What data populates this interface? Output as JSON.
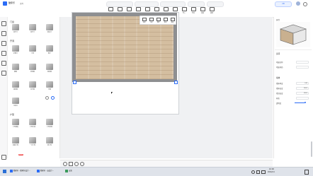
{
  "top": {
    "brand": "酷家乐",
    "file_label": "文件",
    "tools": [
      "撤销",
      "恢复",
      "保存",
      "分享",
      "绘制",
      "方案",
      "工具",
      "视图",
      "导入",
      "导出",
      "渲染",
      "清单"
    ],
    "view_tab": "2D",
    "right_tabs": [
      "渲染",
      "模型",
      "材质"
    ]
  },
  "left": {
    "section_1": "门窗",
    "section_2": "户型",
    "section_3": "开洞",
    "items_1": [
      "单开门",
      "双开门",
      "推拉门",
      "折叠门",
      "门洞",
      "窗户",
      "飘窗",
      "转角窗",
      "弧形窗",
      "落地窗",
      "百叶窗",
      "天窗",
      "垃圾口"
    ],
    "items_2": [
      "户型模板",
      "户型外墙",
      "户型绘制",
      "参数户型",
      "一字户型",
      "新户型"
    ],
    "badge": "NEW"
  },
  "context_toolbar": [
    "绘制",
    "心线",
    "清空",
    "移动",
    "图层"
  ],
  "right": {
    "panel_title": "属性",
    "section_a": "房间",
    "rows": [
      {
        "label": "地面名称",
        "value": ""
      },
      {
        "label": "地面材质",
        "value": ""
      }
    ],
    "section_b": "墙体",
    "rows_b": [
      {
        "label": "墙体厚度",
        "value": "240"
      },
      {
        "label": "墙体高度",
        "value": "2800"
      },
      {
        "label": "墙顶高度",
        "value": "2800"
      },
      {
        "label": "材质",
        "value": ""
      },
      {
        "label": "透明度",
        "value": ""
      }
    ]
  },
  "taskbar": {
    "items": [
      "酷家乐 - 酷家乐设计...",
      "酷家乐 - 云设计...",
      "安装"
    ],
    "time": "10:00",
    "date": "2024/1/1"
  },
  "colors": {
    "floor": "#d4bea0",
    "wall": "#8e8f91",
    "accent": "#2b6cf6"
  }
}
